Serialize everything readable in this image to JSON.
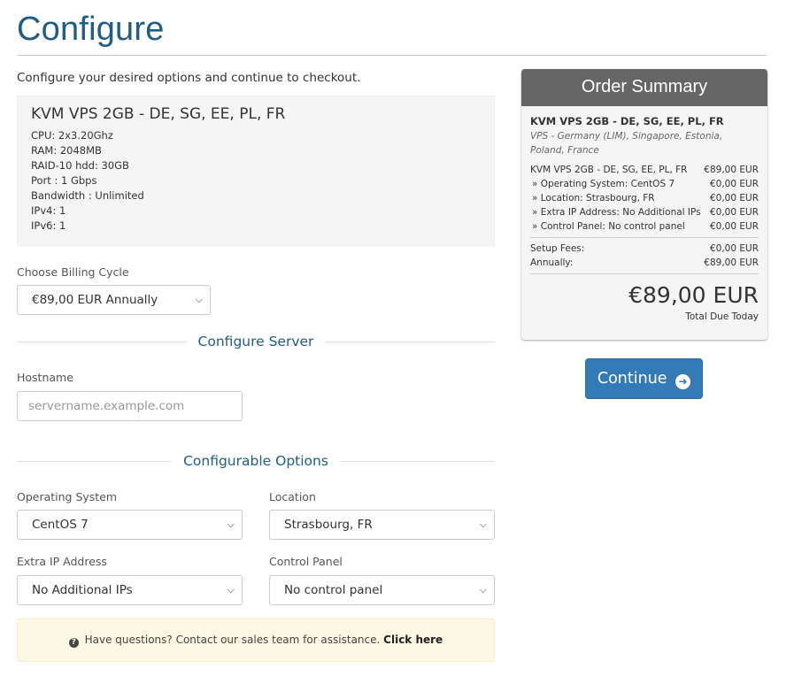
{
  "page": {
    "title": "Configure",
    "intro": "Configure your desired options and continue to checkout."
  },
  "product": {
    "name": "KVM VPS 2GB - DE, SG, EE, PL, FR",
    "specs": [
      "CPU: 2x3.20Ghz",
      "RAM: 2048MB",
      "RAID-10 hdd: 30GB",
      "Port : 1 Gbps",
      "Bandwidth : Unlimited",
      "IPv4: 1",
      "IPv6: 1"
    ]
  },
  "billing": {
    "label": "Choose Billing Cycle",
    "selected": "€89,00 EUR Annually"
  },
  "configure_server": {
    "title": "Configure Server",
    "hostname_label": "Hostname",
    "hostname_placeholder": "servername.example.com"
  },
  "configurable_options": {
    "title": "Configurable Options",
    "os_label": "Operating System",
    "os_value": "CentOS 7",
    "location_label": "Location",
    "location_value": "Strasbourg, FR",
    "extra_ip_label": "Extra IP Address",
    "extra_ip_value": "No Additional IPs",
    "control_panel_label": "Control Panel",
    "control_panel_value": "No control panel"
  },
  "help": {
    "text": "Have questions? Contact our sales team for assistance.",
    "link": "Click here"
  },
  "summary": {
    "title": "Order Summary",
    "product": "KVM VPS 2GB - DE, SG, EE, PL, FR",
    "group": "VPS - Germany (LIM), Singapore, Estonia, Poland, France",
    "lines": [
      {
        "label": "KVM VPS 2GB - DE, SG, EE, PL, FR",
        "amount": "€89,00 EUR"
      },
      {
        "label": "» Operating System: CentOS 7",
        "amount": "€0,00 EUR"
      },
      {
        "label": "» Location: Strasbourg, FR",
        "amount": "€0,00 EUR"
      },
      {
        "label": "» Extra IP Address: No Additional IPs",
        "amount": "€0,00 EUR"
      },
      {
        "label": "» Control Panel: No control panel",
        "amount": "€0,00 EUR"
      }
    ],
    "setup_label": "Setup Fees:",
    "setup_amount": "€0,00 EUR",
    "annual_label": "Annually:",
    "annual_amount": "€89,00 EUR",
    "total": "€89,00 EUR",
    "total_label": "Total Due Today"
  },
  "continue_label": "Continue",
  "colors": {
    "heading": "#1f5d85",
    "primary_button": "#337ab7",
    "summary_header": "#666666",
    "help_bg": "#fcf8e3"
  }
}
